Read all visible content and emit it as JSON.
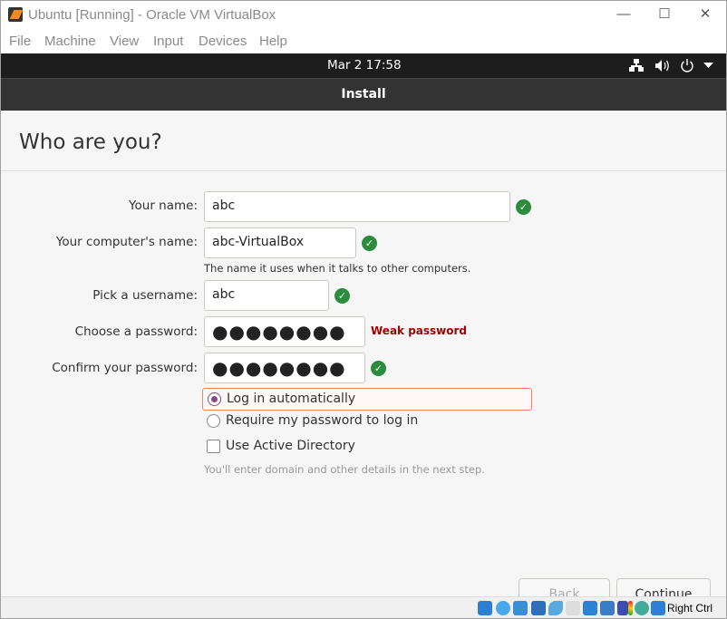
{
  "window": {
    "title": "Ubuntu [Running] - Oracle VM VirtualBox",
    "controls": [
      "minimize",
      "maximize",
      "close"
    ]
  },
  "menu": [
    "File",
    "Machine",
    "View",
    "Input",
    "Devices",
    "Help"
  ],
  "topbar": {
    "clock": "Mar 2  17:58",
    "icons": [
      "network-icon",
      "volume-icon",
      "power-icon",
      "dropdown-icon"
    ]
  },
  "header": {
    "title": "Install"
  },
  "page": {
    "title": "Who are you?"
  },
  "form": {
    "name_label": "Your name:",
    "name_value": "abc",
    "computer_label": "Your computer's name:",
    "computer_value": "abc-VirtualBox",
    "computer_hint": "The name it uses when it talks to other computers.",
    "username_label": "Pick a username:",
    "username_value": "abc",
    "password_label": "Choose a password:",
    "password_value": "●●●●●●●●",
    "password_strength": "Weak password",
    "confirm_label": "Confirm your password:",
    "confirm_value": "●●●●●●●●",
    "login_auto": "Log in automatically",
    "login_password": "Require my password to log in",
    "login_selected": "Log in automatically",
    "active_directory": "Use Active Directory",
    "active_directory_checked": false,
    "ad_hint": "You'll enter domain and other details in the next step."
  },
  "buttons": {
    "back": "Back",
    "continue": "Continue"
  },
  "statusbar": {
    "host_key": "Right Ctrl",
    "colors": {
      "accent": "#8b4a7d",
      "error": "#a40000",
      "ok": "#2a8c3c"
    }
  }
}
